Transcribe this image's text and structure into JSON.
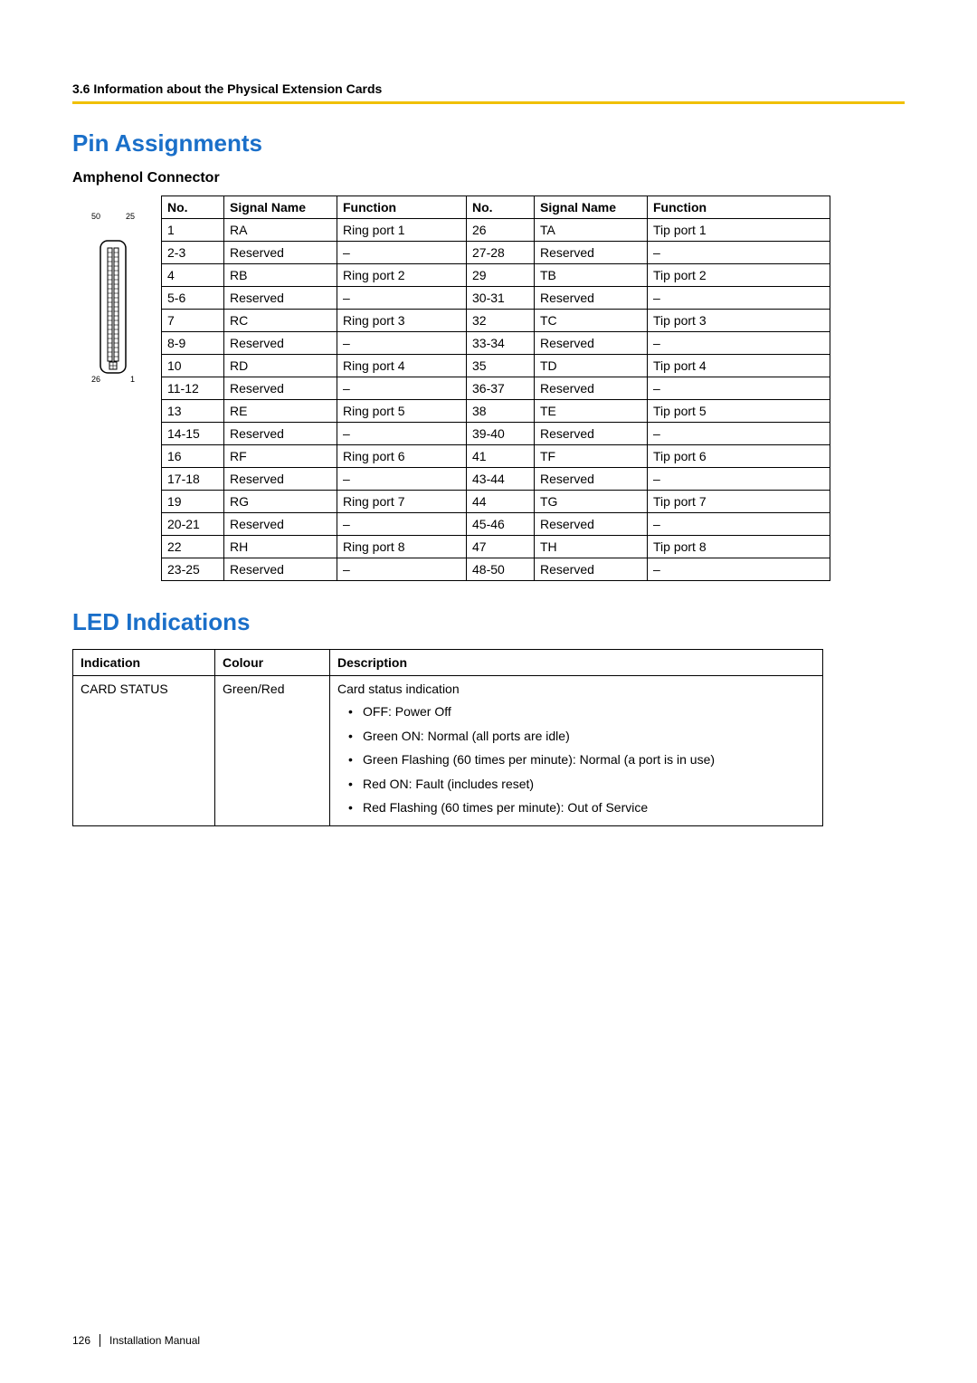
{
  "header": {
    "section": "3.6 Information about the Physical Extension Cards"
  },
  "pin": {
    "title": "Pin Assignments",
    "subtitle": "Amphenol Connector",
    "connector_labels": {
      "top_left": "50",
      "top_right": "25",
      "bottom_left": "26",
      "bottom_right": "1"
    },
    "headers": {
      "no": "No.",
      "signal": "Signal Name",
      "func": "Function"
    },
    "rows": [
      {
        "n1": "1",
        "s1": "RA",
        "f1": "Ring port 1",
        "n2": "26",
        "s2": "TA",
        "f2": "Tip port 1"
      },
      {
        "n1": "2-3",
        "s1": "Reserved",
        "f1": "–",
        "n2": "27-28",
        "s2": "Reserved",
        "f2": "–"
      },
      {
        "n1": "4",
        "s1": "RB",
        "f1": "Ring port 2",
        "n2": "29",
        "s2": "TB",
        "f2": "Tip port 2"
      },
      {
        "n1": "5-6",
        "s1": "Reserved",
        "f1": "–",
        "n2": "30-31",
        "s2": "Reserved",
        "f2": "–"
      },
      {
        "n1": "7",
        "s1": "RC",
        "f1": "Ring port 3",
        "n2": "32",
        "s2": "TC",
        "f2": "Tip port 3"
      },
      {
        "n1": "8-9",
        "s1": "Reserved",
        "f1": "–",
        "n2": "33-34",
        "s2": "Reserved",
        "f2": "–"
      },
      {
        "n1": "10",
        "s1": "RD",
        "f1": "Ring port 4",
        "n2": "35",
        "s2": "TD",
        "f2": "Tip port 4"
      },
      {
        "n1": "11-12",
        "s1": "Reserved",
        "f1": "–",
        "n2": "36-37",
        "s2": "Reserved",
        "f2": "–"
      },
      {
        "n1": "13",
        "s1": "RE",
        "f1": "Ring port 5",
        "n2": "38",
        "s2": "TE",
        "f2": "Tip port 5"
      },
      {
        "n1": "14-15",
        "s1": "Reserved",
        "f1": "–",
        "n2": "39-40",
        "s2": "Reserved",
        "f2": "–"
      },
      {
        "n1": "16",
        "s1": "RF",
        "f1": "Ring port 6",
        "n2": "41",
        "s2": "TF",
        "f2": "Tip port 6"
      },
      {
        "n1": "17-18",
        "s1": "Reserved",
        "f1": "–",
        "n2": "43-44",
        "s2": "Reserved",
        "f2": "–"
      },
      {
        "n1": "19",
        "s1": "RG",
        "f1": "Ring port 7",
        "n2": "44",
        "s2": "TG",
        "f2": "Tip port 7"
      },
      {
        "n1": "20-21",
        "s1": "Reserved",
        "f1": "–",
        "n2": "45-46",
        "s2": "Reserved",
        "f2": "–"
      },
      {
        "n1": "22",
        "s1": "RH",
        "f1": "Ring port 8",
        "n2": "47",
        "s2": "TH",
        "f2": "Tip port 8"
      },
      {
        "n1": "23-25",
        "s1": "Reserved",
        "f1": "–",
        "n2": "48-50",
        "s2": "Reserved",
        "f2": "–"
      }
    ]
  },
  "led": {
    "title": "LED Indications",
    "headers": {
      "indication": "Indication",
      "colour": "Colour",
      "description": "Description"
    },
    "row": {
      "indication": "CARD STATUS",
      "colour": "Green/Red",
      "desc_title": "Card status indication",
      "items": [
        "OFF: Power Off",
        "Green ON: Normal (all ports are idle)",
        "Green Flashing (60 times per minute): Normal (a port is in use)",
        "Red ON: Fault (includes reset)",
        "Red Flashing (60 times per minute): Out of Service"
      ]
    }
  },
  "footer": {
    "page": "126",
    "doc": "Installation Manual"
  }
}
